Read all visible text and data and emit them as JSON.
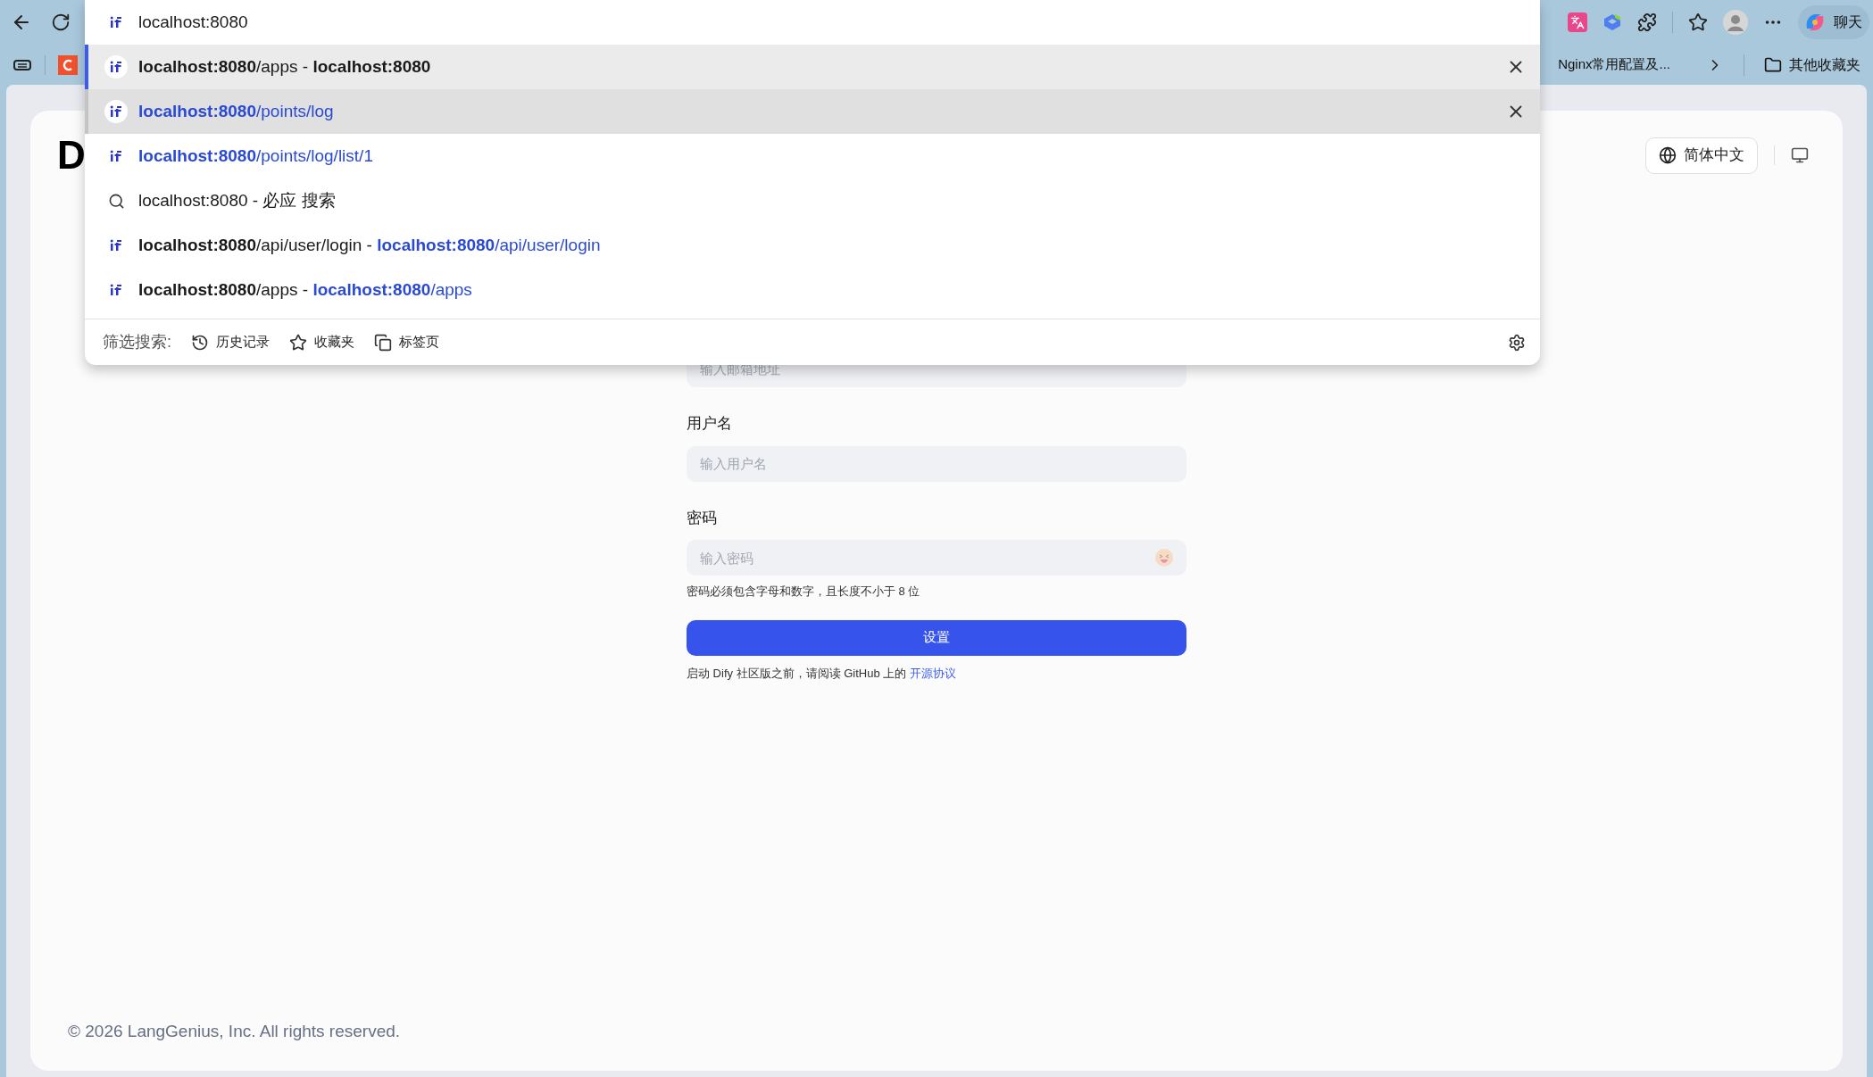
{
  "address_bar": {
    "value": "localhost:8080"
  },
  "suggestions": [
    {
      "kind": "site",
      "selected": true,
      "hovered": false,
      "segments": [
        {
          "text": "localhost:8080",
          "bold": true,
          "link": false
        },
        {
          "text": "/apps",
          "bold": false,
          "link": false
        },
        {
          "text": " - ",
          "bold": false,
          "link": false
        },
        {
          "text": "localhost:8080",
          "bold": true,
          "link": false
        }
      ]
    },
    {
      "kind": "site",
      "selected": false,
      "hovered": true,
      "segments": [
        {
          "text": "localhost:8080",
          "bold": true,
          "link": true
        },
        {
          "text": "/points/log",
          "bold": false,
          "link": true
        }
      ]
    },
    {
      "kind": "site",
      "selected": false,
      "hovered": false,
      "segments": [
        {
          "text": "localhost:8080",
          "bold": true,
          "link": true
        },
        {
          "text": "/points/log/list/1",
          "bold": false,
          "link": true
        }
      ]
    },
    {
      "kind": "search",
      "selected": false,
      "hovered": false,
      "segments": [
        {
          "text": "localhost:8080 - 必应 搜索",
          "bold": false,
          "link": false
        }
      ]
    },
    {
      "kind": "site",
      "selected": false,
      "hovered": false,
      "segments": [
        {
          "text": "localhost:8080",
          "bold": true,
          "link": false
        },
        {
          "text": "/api/user/login - ",
          "bold": false,
          "link": false
        },
        {
          "text": "localhost:8080",
          "bold": true,
          "link": true
        },
        {
          "text": "/api/user/login",
          "bold": false,
          "link": true
        }
      ]
    },
    {
      "kind": "site",
      "selected": false,
      "hovered": false,
      "segments": [
        {
          "text": "localhost:8080",
          "bold": true,
          "link": false
        },
        {
          "text": "/apps - ",
          "bold": false,
          "link": false
        },
        {
          "text": "localhost:8080",
          "bold": true,
          "link": true
        },
        {
          "text": "/apps",
          "bold": false,
          "link": true
        }
      ]
    }
  ],
  "filter": {
    "label": "筛选搜索:",
    "chips": [
      {
        "kind": "history",
        "label": "历史记录"
      },
      {
        "kind": "favorites",
        "label": "收藏夹"
      },
      {
        "kind": "tabs",
        "label": "标签页"
      }
    ]
  },
  "copilot_button": {
    "label": "聊天"
  },
  "bookmarks": {
    "items": [
      {
        "label": "Nginx常用配置及..."
      }
    ],
    "other_folder": "其他收藏夹"
  },
  "page": {
    "logo": "D",
    "language": "简体中文",
    "email": {
      "placeholder": "输入邮箱地址"
    },
    "username": {
      "label": "用户名",
      "placeholder": "输入用户名"
    },
    "password": {
      "label": "密码",
      "placeholder": "输入密码",
      "hint": "密码必须包含字母和数字，且长度不小于 8 位"
    },
    "submit": "设置",
    "notice": {
      "text": "启动 Dify 社区版之前，请阅读 GitHub 上的 ",
      "link": "开源协议"
    },
    "copyright": "© 2026 LangGenius, Inc. All rights reserved."
  }
}
